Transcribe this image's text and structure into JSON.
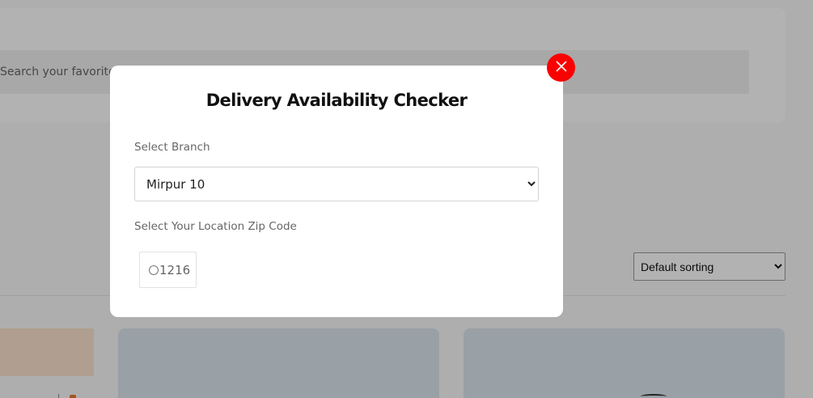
{
  "background": {
    "search": {
      "placeholder": "Search your favorite food"
    },
    "sort": {
      "selected": "Default sorting"
    }
  },
  "modal": {
    "title": "Delivery Availability Checker",
    "branch_label": "Select Branch",
    "branch_selected": "Mirpur 10",
    "zip_label": "Select Your Location Zip Code",
    "zip_options": [
      {
        "value": "1216",
        "checked": false
      }
    ]
  },
  "colors": {
    "close_button": "#fb0000",
    "overlay": "rgba(0,0,0,0.3)"
  },
  "icons": {
    "close": "close-icon"
  }
}
